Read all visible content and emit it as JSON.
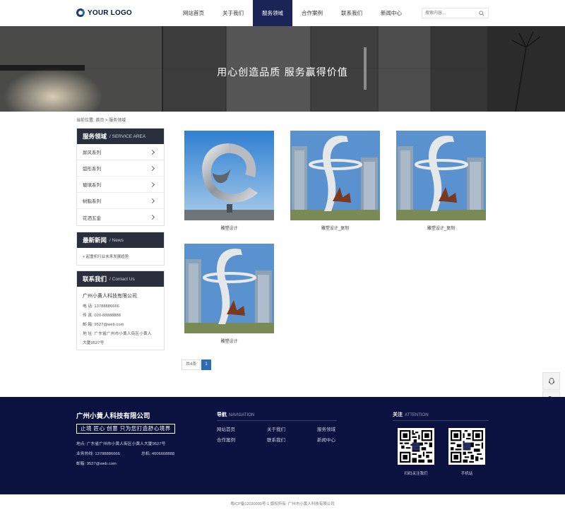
{
  "logo": {
    "text": "YOUR LOGO"
  },
  "nav": {
    "items": [
      "网站首页",
      "关于我们",
      "服务领域",
      "合作案例",
      "联系我们",
      "新闻中心"
    ],
    "active": "服务领域"
  },
  "search": {
    "placeholder": "搜索内容..."
  },
  "banner": {
    "title": "用心创造品质   服务赢得价值"
  },
  "breadcrumb": {
    "text": "当前位置: 首页 > 服务领域"
  },
  "sidebar": {
    "service": {
      "title_cn": "服务领域",
      "title_en": "/ SERVICE AREA",
      "items": [
        "屏风系列",
        "弧形系列",
        "玻璃系列",
        "树脂系列",
        "花洒五金"
      ]
    },
    "news": {
      "title_cn": "最新新闻",
      "title_en": "/ News",
      "items": [
        "起重机行业未来发展趋势"
      ]
    },
    "contact": {
      "title_cn": "联系我们",
      "title_en": "/ Contact Us",
      "company": "广州小黄人科技有限公司",
      "phone": "电 话: 13788886666",
      "fax": "传 真: 020-88888888",
      "email": "邮 箱: 9527@web.com",
      "address_1": "地 址: 广东省广州市小黄人街区小黄人",
      "address_2": "大厦9527号"
    }
  },
  "products": [
    {
      "caption": "雕塑设计"
    },
    {
      "caption": "雕塑设计_复制"
    },
    {
      "caption": "雕塑设计_复制"
    },
    {
      "caption": "雕塑设计"
    }
  ],
  "pagination": {
    "total": "共4条",
    "current": "1"
  },
  "float_toolbar": [
    "qq-icon",
    "phone-icon",
    "qrcode-icon",
    "message-icon",
    "back-to-top-icon"
  ],
  "footer": {
    "company": "广州小黄人科技有限公司",
    "slogan": "止境  匠心  创意  只为您打造舒心境界",
    "address": "地点: 广东省广州市小黄人街区小黄人大厦9527号",
    "hotline": "业务热线: 13788886666",
    "switchboard": "总机: 4006668888",
    "email": "邮箱: 9527@web.com",
    "nav_title": "导航",
    "nav_title_en": "NAVIGATION",
    "nav_links": [
      "网站首页",
      "关于我们",
      "服务领域",
      "合作案例",
      "联系我们",
      "新闻中心"
    ],
    "attention_title": "关注",
    "attention_title_en": "ATTENTION",
    "qr_captions": [
      "扫码关注我们",
      "手机站"
    ]
  },
  "copyright": "粤ICP备12030009号-1 版权所有: 广州市小黄人科技有限公司",
  "colors": {
    "nav_active": "#1b2457",
    "sidebar_header": "#2b2f3d",
    "footer_bg": "#0c1240",
    "pager_active": "#2d6cb5"
  }
}
